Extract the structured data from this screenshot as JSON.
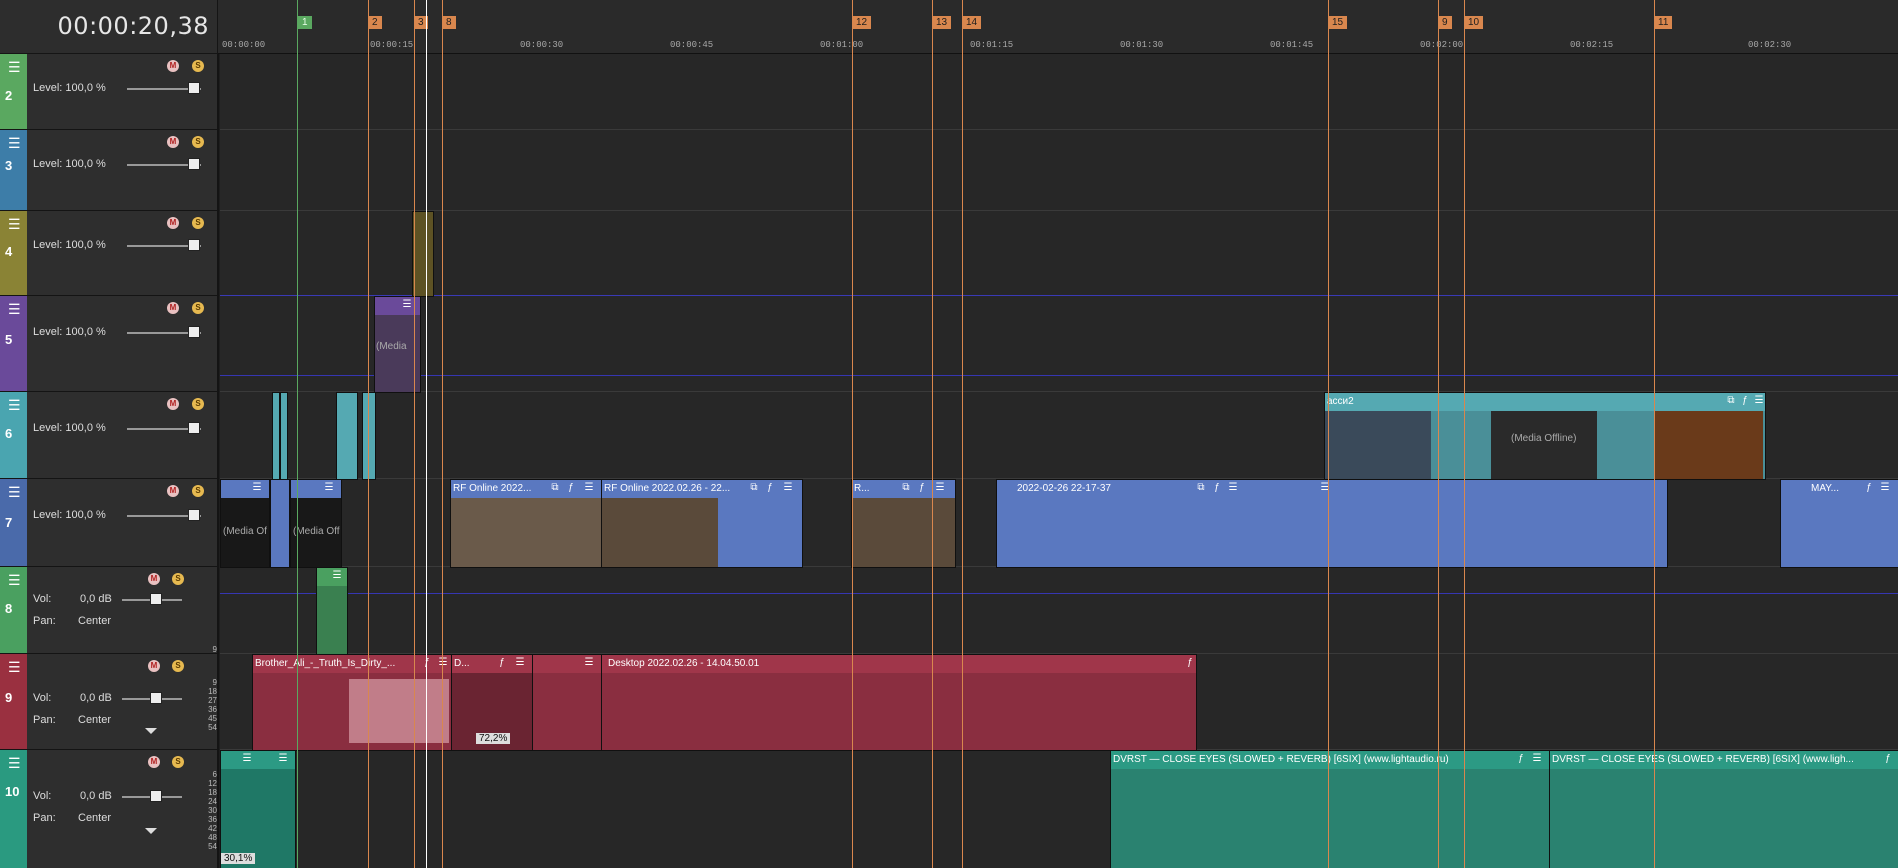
{
  "timecode": "00:00:20,38",
  "ruler": {
    "ticks": [
      "00:00:00",
      "00:00:15",
      "00:00:30",
      "00:00:45",
      "00:01:00",
      "00:01:15",
      "00:01:30",
      "00:01:45",
      "00:02:00",
      "00:02:15",
      "00:02:30"
    ],
    "markers": [
      "1",
      "2",
      "3",
      "8",
      "12",
      "13",
      "14",
      "15",
      "9",
      "10",
      "11"
    ]
  },
  "tracks": [
    {
      "num": "2",
      "level": "Level: 100,0 %",
      "color": "#5aa860"
    },
    {
      "num": "3",
      "level": "Level: 100,0 %",
      "color": "#3d7da8"
    },
    {
      "num": "4",
      "level": "Level: 100,0 %",
      "color": "#8a8335"
    },
    {
      "num": "5",
      "level": "Level: 100,0 %",
      "color": "#6a4a9a"
    },
    {
      "num": "6",
      "level": "Level: 100,0 %",
      "color": "#4aa5b0"
    },
    {
      "num": "7",
      "level": "Level: 100,0 %",
      "color": "#4a6aaa"
    },
    {
      "num": "8",
      "vol": "Vol:",
      "vol_val": "0,0 dB",
      "pan": "Pan:",
      "pan_val": "Center",
      "color": "#4aa060"
    },
    {
      "num": "9",
      "vol": "Vol:",
      "vol_val": "0,0 dB",
      "pan": "Pan:",
      "pan_val": "Center",
      "color": "#9a3040"
    },
    {
      "num": "10",
      "vol": "Vol:",
      "vol_val": "0,0 dB",
      "pan": "Pan:",
      "pan_val": "Center",
      "color": "#2a9a80"
    }
  ],
  "meter_scale_9": [
    "9",
    "18",
    "27",
    "36",
    "45",
    "54"
  ],
  "meter_scale_10": [
    "6",
    "12",
    "18",
    "24",
    "30",
    "36",
    "42",
    "48",
    "54"
  ],
  "clips": {
    "t6_acc": "асси2",
    "t7_rf1": "RF Online 2022...",
    "t7_rf2": "RF Online 2022.02.26 - 22...",
    "t7_r": "R...",
    "t7_date": "2022-02-26 22-17-37",
    "t7_may": "MAY...",
    "t9_brother": "Brother_Ali_-_Truth_Is_Dirty_...",
    "t9_d": "D...",
    "t9_desktop": "Desktop 2022.02.26 - 14.04.50.01",
    "t10_dvrst1": "DVRST — CLOSE EYES (SLOWED + REVERB) [6SIX] (www.lightaudio.ru)",
    "t10_dvrst2": "DVRST — CLOSE EYES (SLOWED + REVERB) [6SIX] (www.ligh..."
  },
  "offline": {
    "label1": "(Media Of",
    "label2": "(Media Off",
    "label3": "(Media Offline)",
    "label4": "(Media"
  },
  "fade_pct1": "72,2%",
  "fade_pct2": "30,1%",
  "colors": {
    "video_clip": "#5a78c0",
    "audio_clip_red": "#a0364a",
    "audio_clip_teal": "#2c9a84",
    "teal_clip": "#55a9b2",
    "marker": "#d9874e"
  }
}
